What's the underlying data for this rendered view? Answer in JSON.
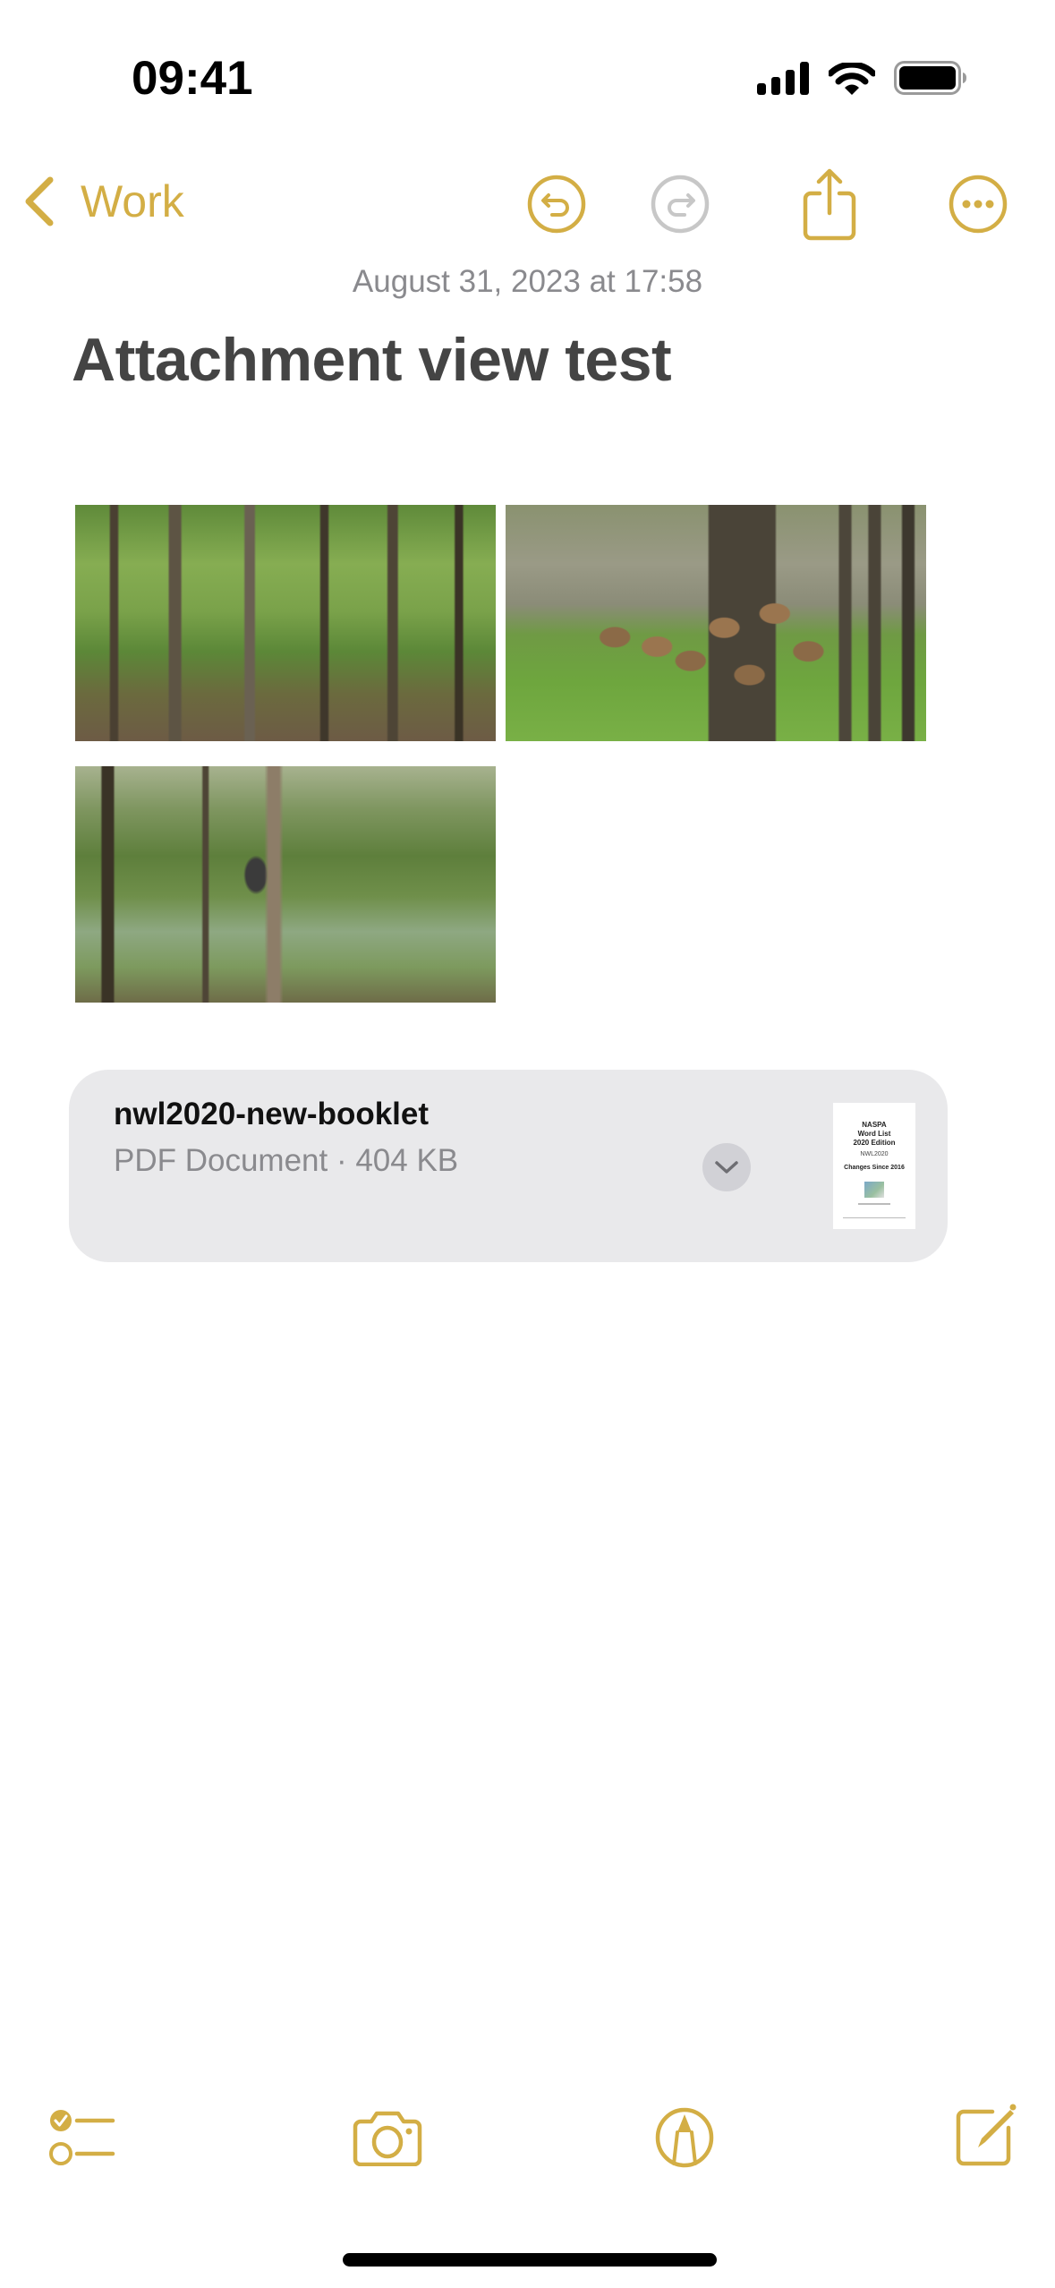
{
  "status_bar": {
    "time": "09:41",
    "icons": [
      "cellular-signal-icon",
      "wifi-icon",
      "battery-icon"
    ]
  },
  "nav": {
    "back_label": "Work",
    "icons": [
      "chevron-left-icon",
      "undo-icon",
      "redo-icon",
      "share-icon",
      "more-icon"
    ],
    "redo_enabled": false
  },
  "note": {
    "date": "August 31, 2023 at 17:58",
    "title": "Attachment view test",
    "images": [
      {
        "description": "forest with trees and dirt path"
      },
      {
        "description": "animals resting on grass under trees"
      },
      {
        "description": "narrow trail through tall grass toward a small shed"
      }
    ],
    "attachment": {
      "filename": "nwl2020-new-booklet",
      "meta": "PDF Document · 404 KB",
      "expand_icon": "chevron-down-icon",
      "thumbnail": {
        "line1": "NASPA",
        "line2": "Word List",
        "line3": "2020 Edition",
        "subtitle": "NWL2020",
        "changes": "Changes Since 2016"
      }
    }
  },
  "toolbar": {
    "items": [
      {
        "name": "checklist",
        "icon": "checklist-icon"
      },
      {
        "name": "camera",
        "icon": "camera-icon"
      },
      {
        "name": "markup",
        "icon": "markup-icon"
      },
      {
        "name": "compose",
        "icon": "compose-icon"
      }
    ]
  },
  "colors": {
    "accent": "#D3AE45",
    "disabled": "#C7C7C7",
    "secondary_text": "#8A8A8E",
    "title_text": "#444444",
    "card_background": "#E9E9EB"
  }
}
